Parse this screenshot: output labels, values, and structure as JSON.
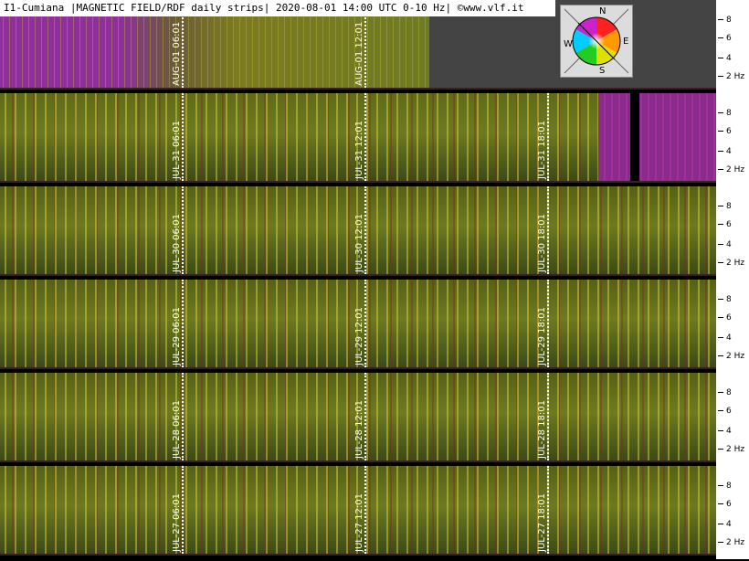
{
  "header": {
    "title": "I1-Cumiana |MAGNETIC FIELD/RDF daily strips| 2020-08-01 14:00 UTC 0-10 Hz| ©www.vlf.it"
  },
  "compass": {
    "north": "N",
    "east": "E",
    "south": "S",
    "west": "W"
  },
  "scale_ticks": [
    "8",
    "6",
    "4",
    "2 Hz"
  ],
  "strips": [
    {
      "labels": [
        "AUG-01 06:01",
        "AUG-01 12:01"
      ],
      "coverage": 0.6
    },
    {
      "labels": [
        "JUL-31 06:01",
        "JUL-31 12:01",
        "JUL-31 18:01"
      ],
      "coverage": 1.0,
      "gap": true
    },
    {
      "labels": [
        "JUL-30 06:01",
        "JUL-30 12:01",
        "JUL-30 18:01"
      ],
      "coverage": 1.0
    },
    {
      "labels": [
        "JUL-29 06:01",
        "JUL-29 12:01",
        "JUL-29 18:01"
      ],
      "coverage": 1.0
    },
    {
      "labels": [
        "JUL-28 06:01",
        "JUL-28 12:01",
        "JUL-28 18:01"
      ],
      "coverage": 1.0
    },
    {
      "labels": [
        "JUL-27 06:01",
        "JUL-27 12:01",
        "JUL-27 18:01"
      ],
      "coverage": 1.0
    }
  ],
  "colors": {
    "purple": "#8a2f8f",
    "olive": "#7a7a1a",
    "green": "#3f5a1c",
    "gray": "#444444"
  }
}
